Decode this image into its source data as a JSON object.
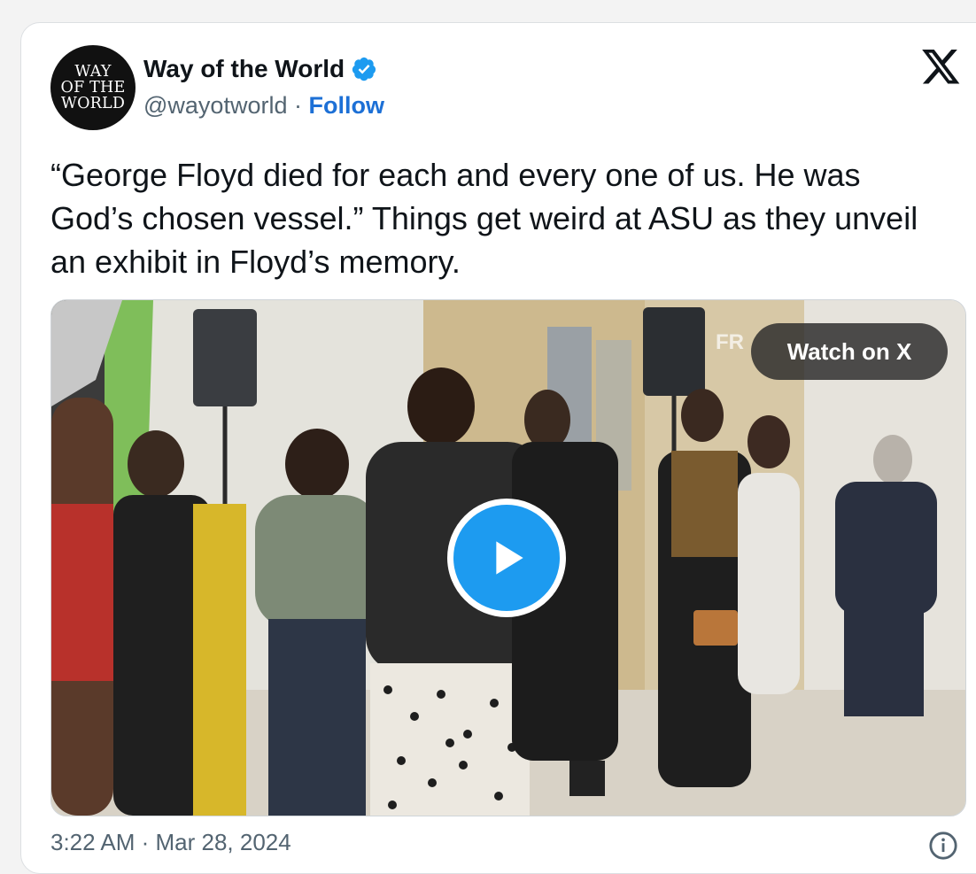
{
  "tweet": {
    "avatar_lines": [
      "WAY",
      "OF THE",
      "WORLD"
    ],
    "display_name": "Way of the World",
    "handle": "@wayotworld",
    "separator": "·",
    "follow_label": "Follow",
    "text": "“George Floyd died for each and every one of us. He was God’s chosen vessel.” Things get weird at ASU as they unveil an exhibit in Floyd’s memory.",
    "watch_label": "Watch on X",
    "timestamp": "3:22 AM · Mar 28, 2024"
  },
  "icons": {
    "verified": "verified-badge-icon",
    "x_logo": "x-logo-icon",
    "play": "play-icon",
    "info": "info-icon"
  },
  "colors": {
    "accent": "#1d9bf0",
    "follow": "#1d70d6",
    "text": "#0f1419",
    "muted": "#536471"
  }
}
